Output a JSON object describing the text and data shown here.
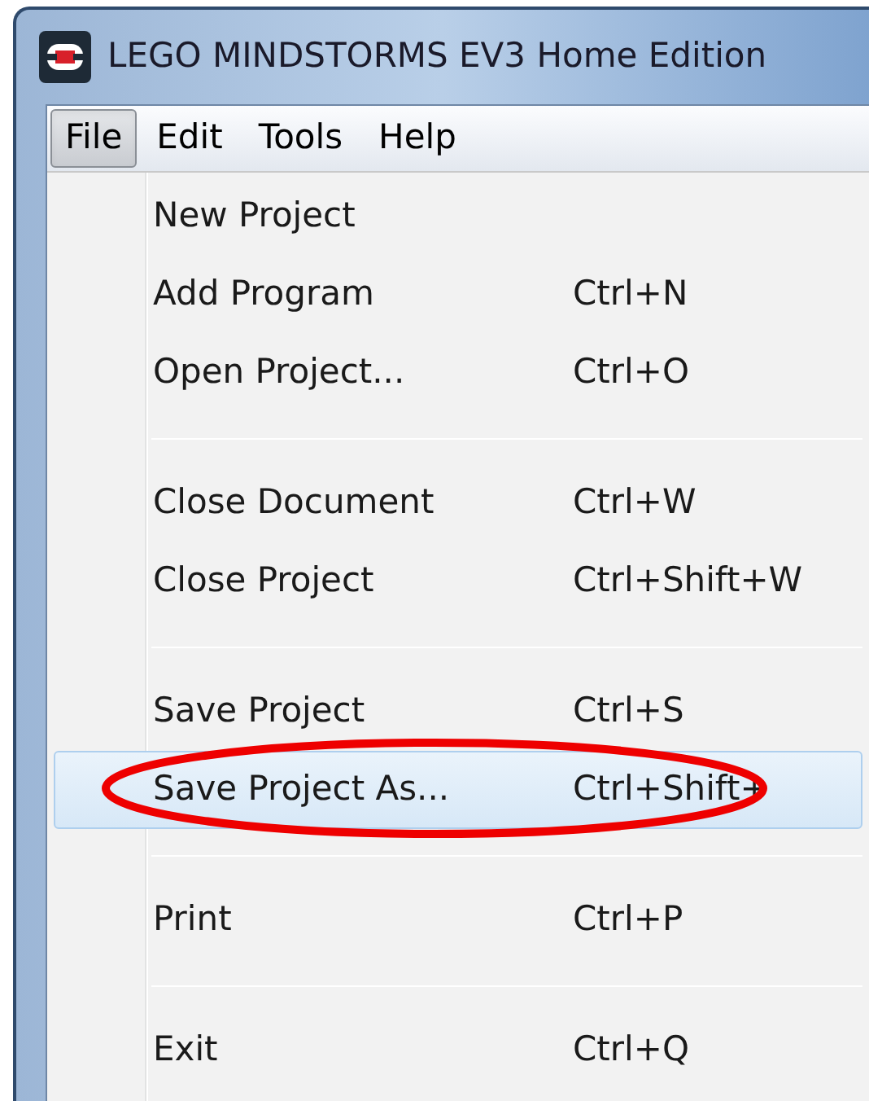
{
  "window": {
    "title": "LEGO MINDSTORMS EV3 Home Edition"
  },
  "menubar": [
    {
      "label": "File",
      "selected": true
    },
    {
      "label": "Edit",
      "selected": false
    },
    {
      "label": "Tools",
      "selected": false
    },
    {
      "label": "Help",
      "selected": false
    }
  ],
  "file_menu": [
    {
      "kind": "item",
      "label": "New Project",
      "selected": false
    },
    {
      "kind": "item",
      "label": "Add Program",
      "shortcut": "Ctrl+N",
      "selected": false
    },
    {
      "kind": "item",
      "label": "Open Project...",
      "shortcut": "Ctrl+O",
      "selected": false
    },
    {
      "kind": "separator"
    },
    {
      "kind": "item",
      "label": "Close Document",
      "shortcut": "Ctrl+W",
      "selected": false
    },
    {
      "kind": "item",
      "label": "Close Project",
      "shortcut": "Ctrl+Shift+W",
      "selected": false
    },
    {
      "kind": "separator"
    },
    {
      "kind": "item",
      "label": "Save Project",
      "shortcut": "Ctrl+S",
      "selected": false
    },
    {
      "kind": "item",
      "label": "Save Project As...",
      "shortcut": "Ctrl+Shift+",
      "selected": true,
      "circled": true
    },
    {
      "kind": "separator"
    },
    {
      "kind": "item",
      "label": "Print",
      "shortcut": "Ctrl+P",
      "selected": false
    },
    {
      "kind": "separator"
    },
    {
      "kind": "item",
      "label": "Exit",
      "shortcut": "Ctrl+Q",
      "selected": false
    }
  ]
}
